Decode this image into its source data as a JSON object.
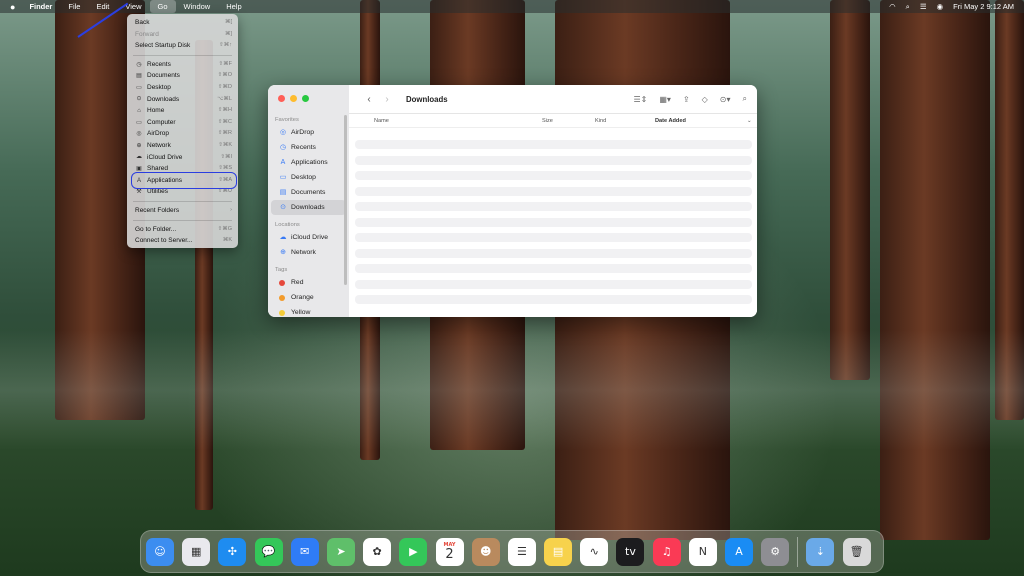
{
  "menubar": {
    "apple": "",
    "app_name": "Finder",
    "items": [
      "File",
      "Edit",
      "View",
      "Go",
      "Window",
      "Help"
    ],
    "active": "Go",
    "date_time": "Fri May 2  9:12 AM"
  },
  "go_menu": {
    "items": [
      {
        "label": "Back",
        "shortcut": "⌘[",
        "icon": "",
        "disabled": false
      },
      {
        "label": "Forward",
        "shortcut": "⌘]",
        "icon": "",
        "disabled": true
      },
      {
        "label": "Select Startup Disk",
        "shortcut": "⇧⌘↑",
        "icon": "",
        "disabled": false
      },
      {
        "sep": true
      },
      {
        "label": "Recents",
        "shortcut": "⇧⌘F",
        "icon": "◷"
      },
      {
        "label": "Documents",
        "shortcut": "⇧⌘O",
        "icon": "▤"
      },
      {
        "label": "Desktop",
        "shortcut": "⇧⌘D",
        "icon": "▭"
      },
      {
        "label": "Downloads",
        "shortcut": "⌥⌘L",
        "icon": "⊙"
      },
      {
        "label": "Home",
        "shortcut": "⇧⌘H",
        "icon": "⌂"
      },
      {
        "label": "Computer",
        "shortcut": "⇧⌘C",
        "icon": "▭"
      },
      {
        "label": "AirDrop",
        "shortcut": "⇧⌘R",
        "icon": "◎"
      },
      {
        "label": "Network",
        "shortcut": "⇧⌘K",
        "icon": "⊕"
      },
      {
        "label": "iCloud Drive",
        "shortcut": "⇧⌘I",
        "icon": "☁"
      },
      {
        "label": "Shared",
        "shortcut": "⇧⌘S",
        "icon": "▣"
      },
      {
        "label": "Applications",
        "shortcut": "⇧⌘A",
        "icon": "A"
      },
      {
        "label": "Utilities",
        "shortcut": "⇧⌘U",
        "icon": "⚒"
      },
      {
        "sep": true
      },
      {
        "label": "Recent Folders",
        "shortcut": "›",
        "icon": ""
      },
      {
        "sep": true
      },
      {
        "label": "Go to Folder...",
        "shortcut": "⇧⌘G",
        "icon": ""
      },
      {
        "label": "Connect to Server...",
        "shortcut": "⌘K",
        "icon": ""
      }
    ]
  },
  "finder": {
    "title": "Downloads",
    "sidebar": {
      "favorites_header": "Favorites",
      "favorites": [
        {
          "label": "AirDrop",
          "icon": "◎"
        },
        {
          "label": "Recents",
          "icon": "◷"
        },
        {
          "label": "Applications",
          "icon": "A"
        },
        {
          "label": "Desktop",
          "icon": "▭"
        },
        {
          "label": "Documents",
          "icon": "▤"
        },
        {
          "label": "Downloads",
          "icon": "⊙"
        }
      ],
      "locations_header": "Locations",
      "locations": [
        {
          "label": "iCloud Drive",
          "icon": "☁"
        },
        {
          "label": "Network",
          "icon": "⊕"
        }
      ],
      "tags_header": "Tags",
      "tags": [
        {
          "label": "Red",
          "color": "#e5483b"
        },
        {
          "label": "Orange",
          "color": "#f29b2c"
        },
        {
          "label": "Yellow",
          "color": "#f4cd3a"
        }
      ]
    },
    "columns": {
      "name": "Name",
      "size": "Size",
      "kind": "Kind",
      "date": "Date Added"
    }
  },
  "dock": {
    "apps": [
      {
        "name": "finder-icon",
        "bg": "#3c8df0",
        "glyph": "☺"
      },
      {
        "name": "launchpad-icon",
        "bg": "#e9e9ee",
        "glyph": "▦"
      },
      {
        "name": "safari-icon",
        "bg": "#1e8cf0",
        "glyph": "✣"
      },
      {
        "name": "messages-icon",
        "bg": "#34c759",
        "glyph": "💬"
      },
      {
        "name": "mail-icon",
        "bg": "#2f7cf6",
        "glyph": "✉"
      },
      {
        "name": "maps-icon",
        "bg": "#5fbf6a",
        "glyph": "➤"
      },
      {
        "name": "photos-icon",
        "bg": "#ffffff",
        "glyph": "✿"
      },
      {
        "name": "facetime-icon",
        "bg": "#34c759",
        "glyph": "▶"
      },
      {
        "name": "calendar-icon",
        "bg": "#ffffff",
        "glyph": "2"
      },
      {
        "name": "contacts-icon",
        "bg": "#b98a5e",
        "glyph": "☻"
      },
      {
        "name": "reminders-icon",
        "bg": "#ffffff",
        "glyph": "☰"
      },
      {
        "name": "notes-icon",
        "bg": "#f7d24c",
        "glyph": "▤"
      },
      {
        "name": "freeform-icon",
        "bg": "#ffffff",
        "glyph": "∿"
      },
      {
        "name": "tv-icon",
        "bg": "#1c1c1e",
        "glyph": "tv"
      },
      {
        "name": "music-icon",
        "bg": "#fa3a55",
        "glyph": "♫"
      },
      {
        "name": "news-icon",
        "bg": "#ffffff",
        "glyph": "N"
      },
      {
        "name": "app-store-icon",
        "bg": "#1a8cf4",
        "glyph": "A"
      },
      {
        "name": "system-settings-icon",
        "bg": "#8e8e93",
        "glyph": "⚙"
      },
      {
        "divider": true
      },
      {
        "name": "downloads-folder-icon",
        "bg": "#6aa9e8",
        "glyph": "⇣"
      },
      {
        "name": "trash-icon",
        "bg": "#d9d9d9",
        "glyph": "🗑"
      }
    ],
    "calendar_month": "MAY"
  }
}
